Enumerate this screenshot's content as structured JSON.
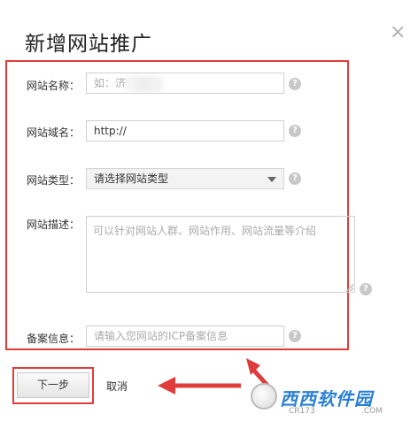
{
  "dialog": {
    "title": "新增网站推广",
    "close_symbol": "×"
  },
  "form": {
    "name_label": "网站名称：",
    "name_placeholder": "如：济",
    "domain_label": "网站域名：",
    "domain_value": "http://",
    "type_label": "网站类型：",
    "type_selected": "请选择网站类型",
    "desc_label": "网站描述：",
    "desc_placeholder": "可以针对网站人群、网站作用、网站流量等介绍",
    "icp_label": "备案信息：",
    "icp_placeholder": "请输入您网站的ICP备案信息",
    "help_symbol": "?"
  },
  "actions": {
    "next_label": "下一步",
    "cancel_label": "取消"
  },
  "watermark": {
    "brand": "西西软件园",
    "site_left": "CR173",
    "site_right": ".COM"
  },
  "colors": {
    "highlight": "#e03c3c",
    "watermark_blue": "#2a7fd4"
  },
  "icons": {
    "close": "close-icon",
    "help": "help-icon",
    "select_caret": "chevron-down-icon"
  }
}
